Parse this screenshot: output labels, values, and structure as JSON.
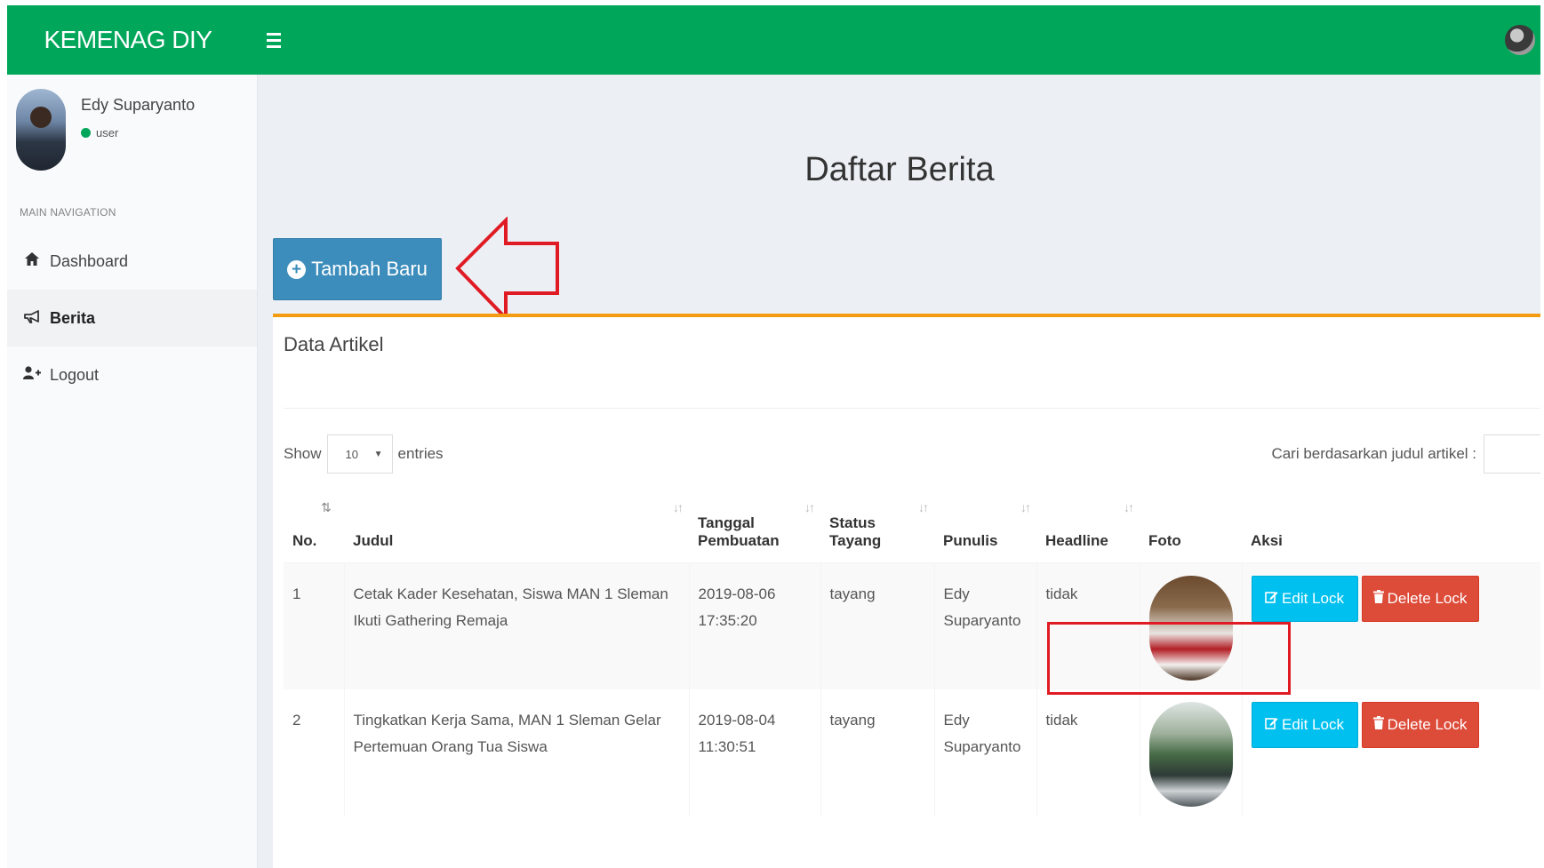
{
  "header": {
    "brand": "KEMENAG DIY"
  },
  "sidebar": {
    "user_name": "Edy Suparyanto",
    "user_status": "user",
    "nav_header": "MAIN NAVIGATION",
    "items": [
      {
        "label": "Dashboard",
        "icon": "home-icon"
      },
      {
        "label": "Berita",
        "icon": "bullhorn-icon",
        "active": true
      },
      {
        "label": "Logout",
        "icon": "user-plus-icon"
      }
    ]
  },
  "main": {
    "title": "Daftar Berita",
    "add_button": "Tambah Baru",
    "box_title": "Data Artikel",
    "show_label": "Show",
    "entries_value": "10",
    "entries_label": "entries",
    "search_label": "Cari berdasarkan judul artikel :",
    "columns": {
      "no": "No.",
      "judul": "Judul",
      "tanggal_1": "Tanggal",
      "tanggal_2": "Pembuatan",
      "status_1": "Status",
      "status_2": "Tayang",
      "penulis": "Punulis",
      "headline": "Headline",
      "foto": "Foto",
      "aksi": "Aksi"
    },
    "rows": [
      {
        "no": "1",
        "judul": "Cetak Kader Kesehatan, Siswa MAN 1 Sleman Ikuti Gathering Remaja",
        "tanggal": "2019-08-06 17:35:20",
        "status": "tayang",
        "penulis_1": "Edy",
        "penulis_2": "Suparyanto",
        "headline": "tidak",
        "edit": "Edit Lock",
        "delete": "Delete Lock"
      },
      {
        "no": "2",
        "judul": "Tingkatkan Kerja Sama, MAN 1 Sleman Gelar Pertemuan Orang Tua Siswa",
        "tanggal": "2019-08-04 11:30:51",
        "status": "tayang",
        "penulis_1": "Edy",
        "penulis_2": "Suparyanto",
        "headline": "tidak",
        "edit": "Edit Lock",
        "delete": "Delete Lock"
      }
    ]
  },
  "colors": {
    "header": "#00a65a",
    "primary": "#3c8dbc",
    "info": "#00c0ef",
    "danger": "#dd4b39",
    "box_border": "#f39c12",
    "annotation": "#e01b24"
  }
}
